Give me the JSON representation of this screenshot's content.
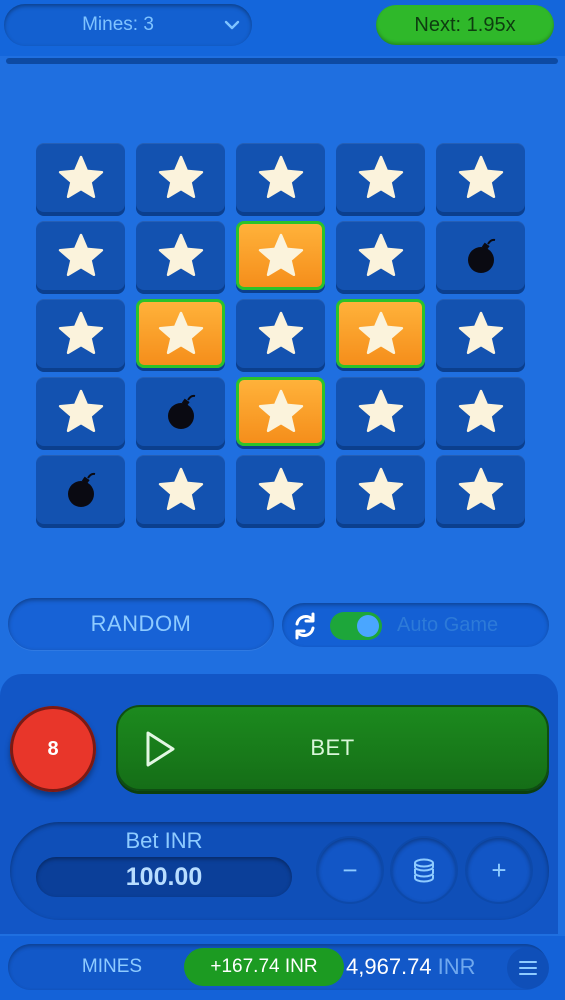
{
  "header": {
    "mines_label": "Mines: 3",
    "next_multiplier": "Next: 1.95x"
  },
  "board": {
    "rows": 5,
    "cols": 5,
    "tiles": [
      [
        "star",
        "star",
        "star",
        "star",
        "star"
      ],
      [
        "star",
        "star",
        "revealed-star",
        "star",
        "mine"
      ],
      [
        "star",
        "revealed-star",
        "star",
        "revealed-star",
        "star"
      ],
      [
        "star",
        "mine",
        "revealed-star",
        "star",
        "star"
      ],
      [
        "mine",
        "star",
        "star",
        "star",
        "star"
      ]
    ]
  },
  "controls": {
    "random_label": "RANDOM",
    "auto_game_label": "Auto Game",
    "auto_game_on": true,
    "refresh_icon": "refresh-icon"
  },
  "bet": {
    "counter": "8",
    "bet_button_label": "BET",
    "caption": "Bet INR",
    "amount": "100.00",
    "minus_label": "−",
    "plus_label": "+",
    "coins_icon": "coins-icon"
  },
  "footer": {
    "mines_label": "MINES",
    "win_amount": "+167.74 INR",
    "balance_value": "4,967.74",
    "balance_currency": "INR",
    "menu_icon": "menu-icon"
  },
  "colors": {
    "background": "#1f6fe0",
    "tile": "#1352b0",
    "revealed_tile": "#f7a02a",
    "revealed_border": "#2bc22a",
    "star": "#fbf3dc",
    "next_badge": "#2fb82a",
    "bet_button": "#1c8a1e",
    "counter_circle": "#e8362a"
  }
}
